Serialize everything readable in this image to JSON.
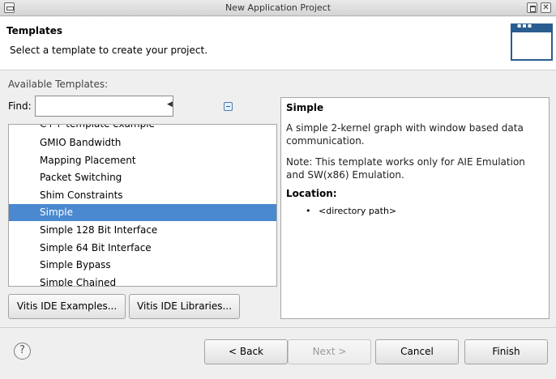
{
  "window": {
    "title": "New Application Project",
    "close_glyph": "✕"
  },
  "header": {
    "title": "Templates",
    "subtitle": "Select a template to create your project.",
    "icon": "wizard-banner-icon"
  },
  "available_label": "Available Templates:",
  "find": {
    "label": "Find:",
    "value": ""
  },
  "templates": [
    {
      "label": "C++ template example",
      "selected": false
    },
    {
      "label": "GMIO Bandwidth",
      "selected": false
    },
    {
      "label": "Mapping Placement",
      "selected": false
    },
    {
      "label": "Packet Switching",
      "selected": false
    },
    {
      "label": "Shim Constraints",
      "selected": false
    },
    {
      "label": "Simple",
      "selected": true
    },
    {
      "label": "Simple 128 Bit Interface",
      "selected": false
    },
    {
      "label": "Simple 64 Bit Interface",
      "selected": false
    },
    {
      "label": "Simple Bypass",
      "selected": false
    },
    {
      "label": "Simple Chained",
      "selected": false
    }
  ],
  "description": {
    "title": "Simple",
    "body": "A simple 2-kernel graph with window based data communication.",
    "note": "Note: This template works only for AIE Emulation and SW(x86) Emulation.",
    "location_label": "Location:",
    "location_value": "<directory path>"
  },
  "buttons": {
    "examples": "Vitis IDE Examples...",
    "libraries": "Vitis IDE Libraries...",
    "back": "< Back",
    "next": "Next >",
    "cancel": "Cancel",
    "finish": "Finish",
    "help": "?"
  },
  "colors": {
    "selection": "#4a88d0",
    "banner_icon": "#2a5d8f"
  }
}
